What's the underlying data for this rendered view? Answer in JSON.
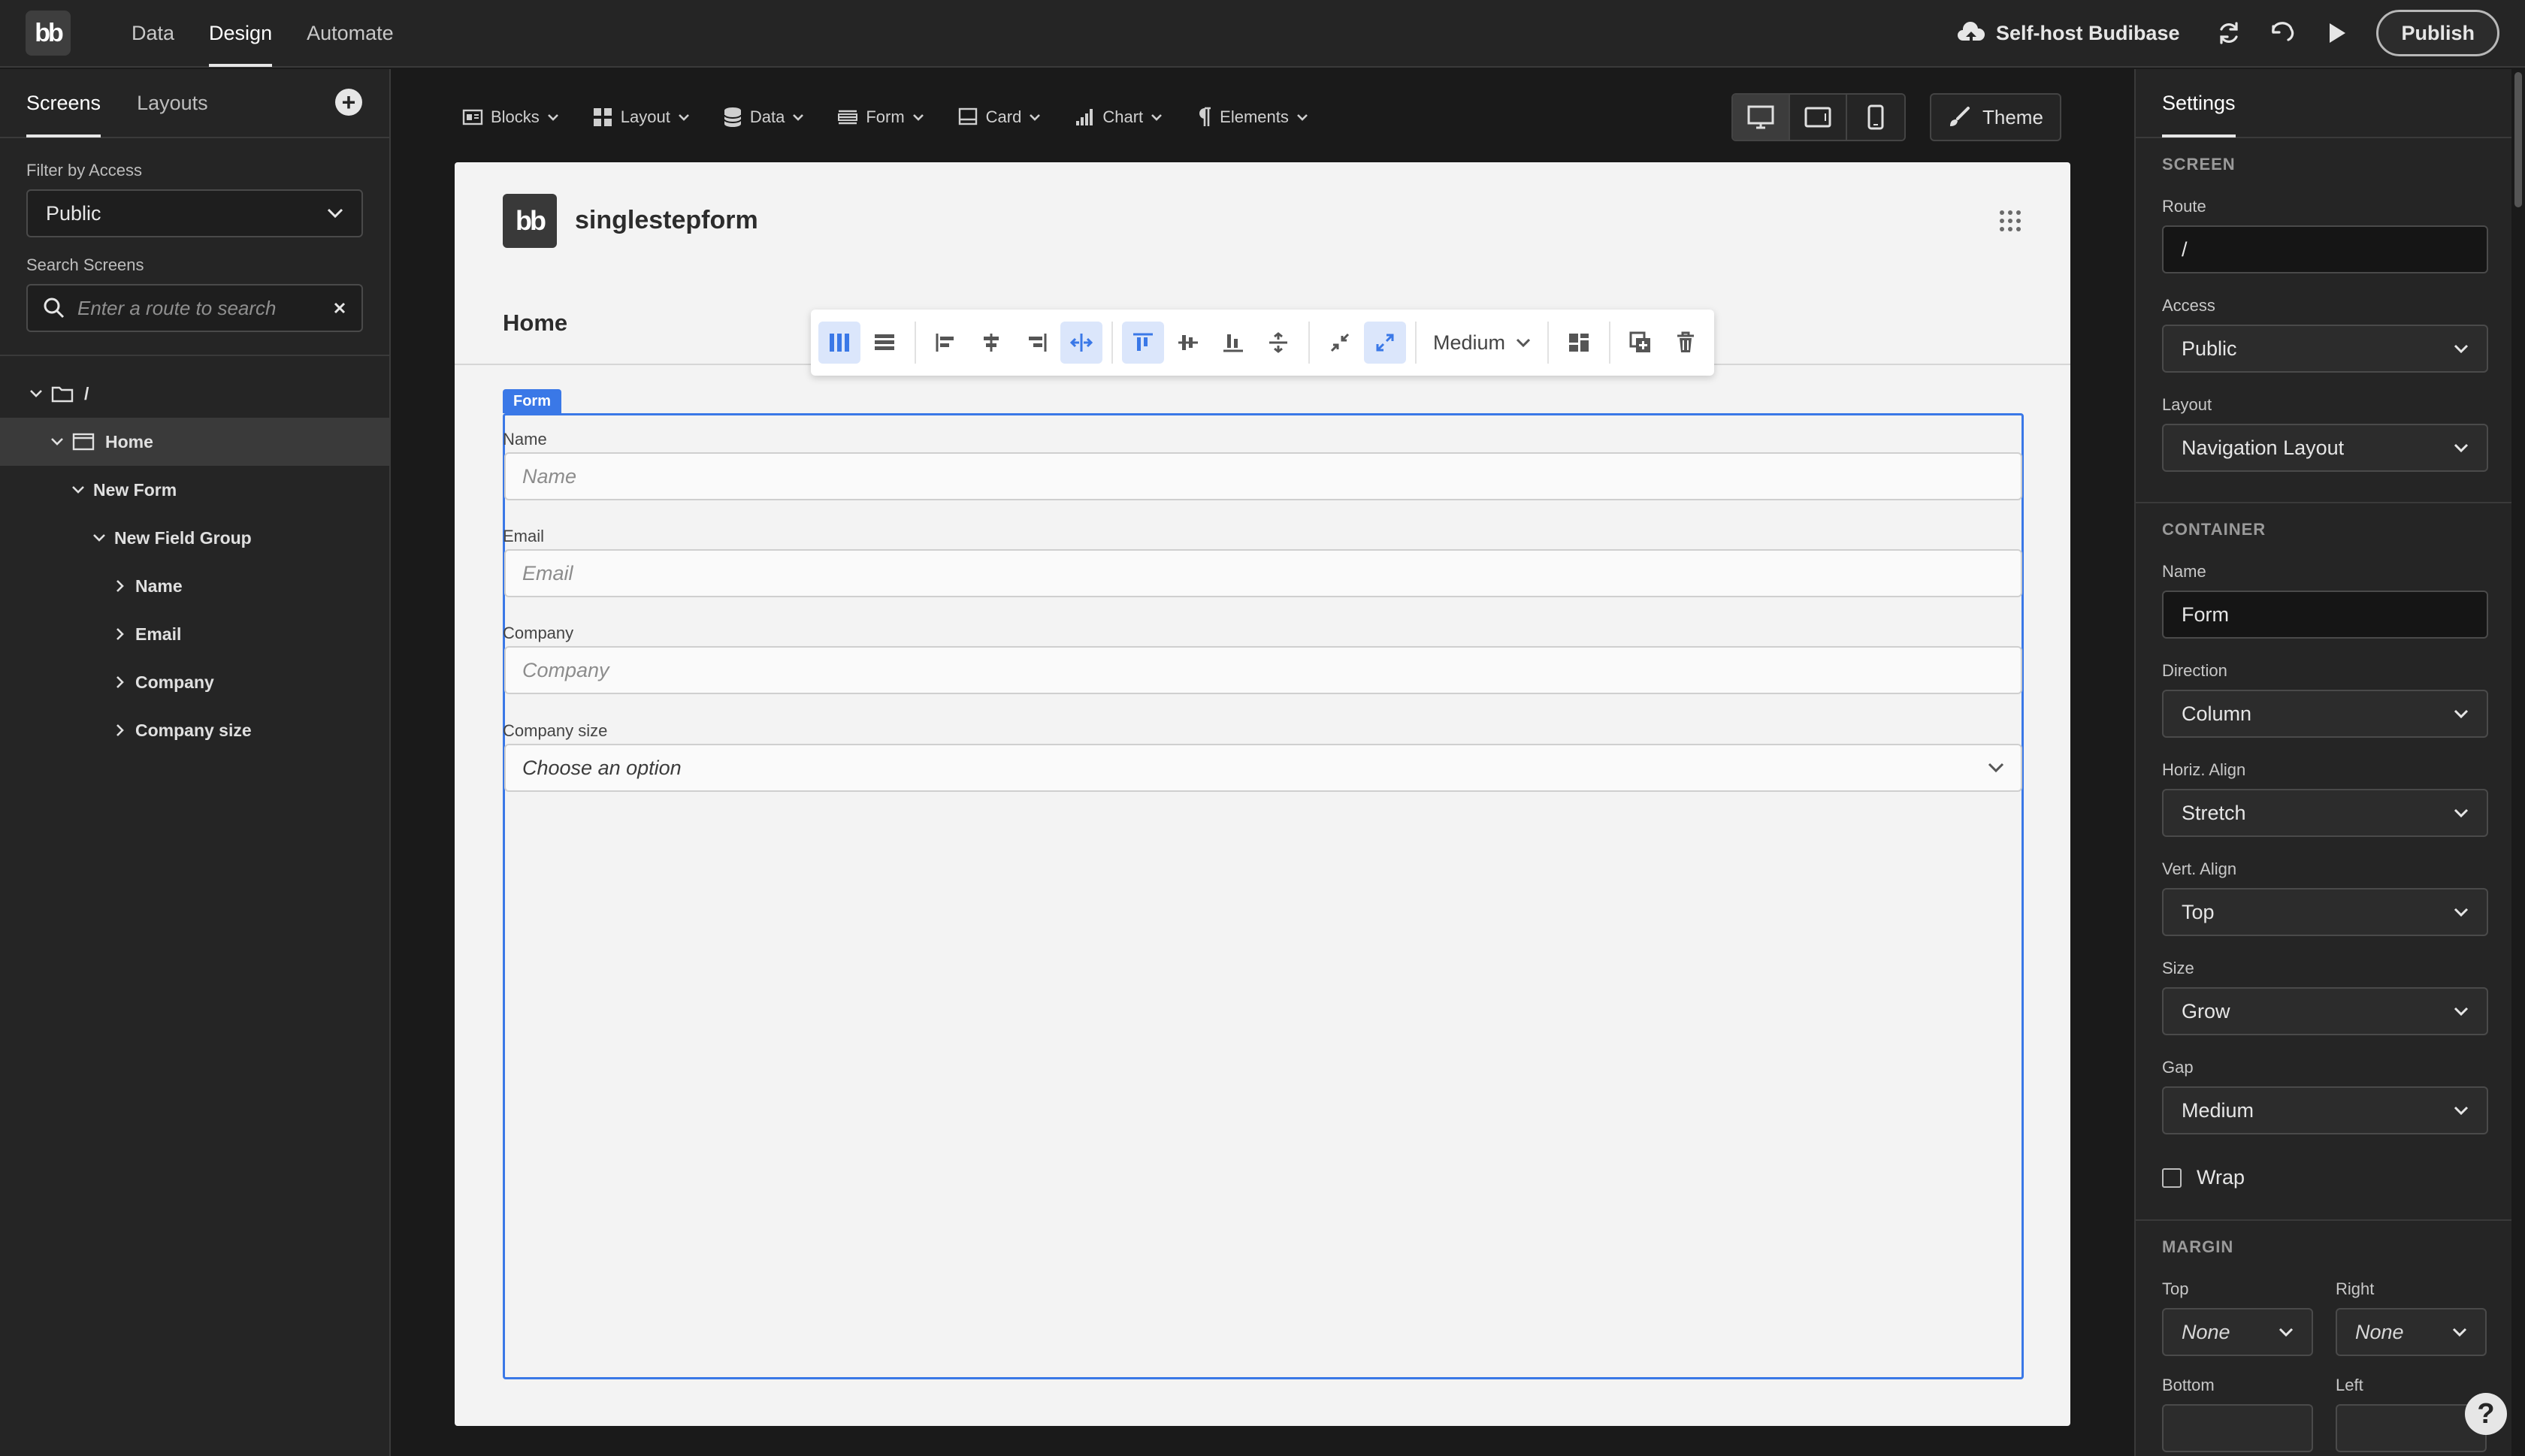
{
  "topbar": {
    "logo_text": "bb",
    "tabs": [
      "Data",
      "Design",
      "Automate"
    ],
    "active_tab": "Design",
    "selfhost_label": "Self-host Budibase",
    "publish_label": "Publish"
  },
  "left": {
    "tabs": [
      "Screens",
      "Layouts"
    ],
    "filter_label": "Filter by Access",
    "filter_value": "Public",
    "search_label": "Search Screens",
    "search_placeholder": "Enter a route to search",
    "tree": [
      {
        "label": "/",
        "level": 0,
        "type": "folder"
      },
      {
        "label": "Home",
        "level": 1,
        "type": "screen",
        "selected": true
      },
      {
        "label": "New Form",
        "level": 2,
        "type": "component"
      },
      {
        "label": "New Field Group",
        "level": 3,
        "type": "component"
      },
      {
        "label": "Name",
        "level": 4,
        "type": "leaf"
      },
      {
        "label": "Email",
        "level": 4,
        "type": "leaf"
      },
      {
        "label": "Company",
        "level": 4,
        "type": "leaf"
      },
      {
        "label": "Company size",
        "level": 4,
        "type": "leaf"
      }
    ]
  },
  "componentbar": {
    "items": [
      {
        "label": "Blocks",
        "icon": "blocks-icon"
      },
      {
        "label": "Layout",
        "icon": "layout-icon"
      },
      {
        "label": "Data",
        "icon": "database-icon"
      },
      {
        "label": "Form",
        "icon": "form-icon"
      },
      {
        "label": "Card",
        "icon": "card-icon"
      },
      {
        "label": "Chart",
        "icon": "chart-icon"
      },
      {
        "label": "Elements",
        "icon": "paragraph-icon"
      }
    ],
    "theme_label": "Theme"
  },
  "preview": {
    "logo_text": "bb",
    "app_title": "singlestepform",
    "page_title": "Home",
    "toolbar_size": "Medium",
    "form_tag": "Form",
    "fields": [
      {
        "label": "Name",
        "placeholder": "Name"
      },
      {
        "label": "Email",
        "placeholder": "Email"
      },
      {
        "label": "Company",
        "placeholder": "Company"
      }
    ],
    "select_field": {
      "label": "Company size",
      "value": "Choose an option"
    }
  },
  "settings": {
    "tab": "Settings",
    "screen_section": "SCREEN",
    "route_label": "Route",
    "route_value": "/",
    "access_label": "Access",
    "access_value": "Public",
    "layout_label": "Layout",
    "layout_value": "Navigation Layout",
    "container_section": "CONTAINER",
    "name_label": "Name",
    "name_value": "Form",
    "direction_label": "Direction",
    "direction_value": "Column",
    "halign_label": "Horiz. Align",
    "halign_value": "Stretch",
    "valign_label": "Vert. Align",
    "valign_value": "Top",
    "size_label": "Size",
    "size_value": "Grow",
    "gap_label": "Gap",
    "gap_value": "Medium",
    "wrap_label": "Wrap",
    "margin_section": "MARGIN",
    "top_label": "Top",
    "top_value": "None",
    "right_label": "Right",
    "right_value": "None",
    "bottom_label": "Bottom",
    "left_label": "Left"
  },
  "colors": {
    "accent": "#3a78e7",
    "panel": "#252525",
    "canvas": "#1a1a1a",
    "preview_bg": "#f3f3f3"
  }
}
